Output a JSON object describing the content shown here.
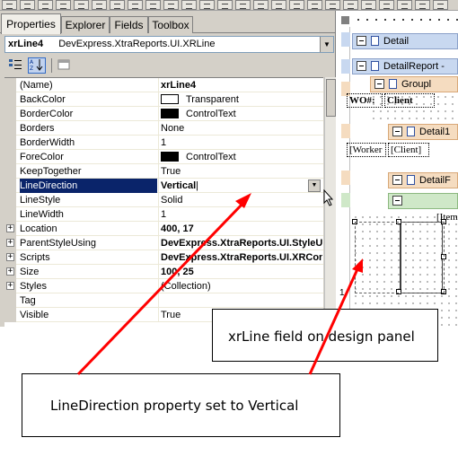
{
  "tabs": [
    {
      "label": "Properties",
      "active": true
    },
    {
      "label": "Explorer",
      "active": false
    },
    {
      "label": "Fields",
      "active": false
    },
    {
      "label": "Toolbox",
      "active": false
    }
  ],
  "object_selector": {
    "name": "xrLine4",
    "type": "DevExpress.XtraReports.UI.XRLine"
  },
  "grid_toolbar": {
    "categorized_icon": "categorized-icon",
    "alphabetical_icon": "alphabetical-sort-icon",
    "property_pages_icon": "property-pages-icon"
  },
  "properties": [
    {
      "name": "(Name)",
      "value": "xrLine4",
      "bold": true,
      "expandable": false
    },
    {
      "name": "BackColor",
      "value": "Transparent",
      "swatch": "#ffffff",
      "bold": false,
      "expandable": false
    },
    {
      "name": "BorderColor",
      "value": "ControlText",
      "swatch": "#000000",
      "bold": false,
      "expandable": false
    },
    {
      "name": "Borders",
      "value": "None",
      "bold": false,
      "expandable": false
    },
    {
      "name": "BorderWidth",
      "value": "1",
      "bold": false,
      "expandable": false
    },
    {
      "name": "ForeColor",
      "value": "ControlText",
      "swatch": "#000000",
      "bold": false,
      "expandable": false
    },
    {
      "name": "KeepTogether",
      "value": "True",
      "bold": false,
      "expandable": false
    },
    {
      "name": "LineDirection",
      "value": "Vertical",
      "bold": true,
      "expandable": false,
      "selected": true
    },
    {
      "name": "LineStyle",
      "value": "Solid",
      "bold": false,
      "expandable": false
    },
    {
      "name": "LineWidth",
      "value": "1",
      "bold": false,
      "expandable": false
    },
    {
      "name": "Location",
      "value": "400, 17",
      "bold": true,
      "expandable": true
    },
    {
      "name": "ParentStyleUsing",
      "value": "DevExpress.XtraReports.UI.StyleU",
      "bold": true,
      "expandable": true
    },
    {
      "name": "Scripts",
      "value": "DevExpress.XtraReports.UI.XRCon",
      "bold": true,
      "expandable": true
    },
    {
      "name": "Size",
      "value": "100, 25",
      "bold": true,
      "expandable": true
    },
    {
      "name": "Styles",
      "value": "(Collection)",
      "bold": false,
      "expandable": true
    },
    {
      "name": "Tag",
      "value": "",
      "bold": false,
      "expandable": false
    },
    {
      "name": "Visible",
      "value": "True",
      "bold": false,
      "expandable": false
    }
  ],
  "design_surface": {
    "sections": [
      {
        "label": "Detail",
        "color": "blue"
      },
      {
        "label": "DetailReport -",
        "color": "blue"
      },
      {
        "label": "Groupl",
        "color": "orange"
      },
      {
        "label": "Detail1",
        "color": "orange"
      },
      {
        "label": "DetailF",
        "color": "orange"
      },
      {
        "label": "",
        "color": "green"
      }
    ],
    "labels": {
      "wo": "WO#:",
      "client": "Client",
      "worker": "[Worker",
      "client_field": "[Client]",
      "item": "[Item"
    },
    "ruler_mark": "1"
  },
  "callouts": {
    "design_panel": "xrLine field on design panel",
    "line_direction": "LineDirection property set to Vertical"
  },
  "colors": {
    "selection": "#0a246a",
    "arrow": "#ff0000",
    "detail_band": "#c8d8f0",
    "group_band": "#f5dcc0",
    "footer_band": "#cfe8c8"
  }
}
